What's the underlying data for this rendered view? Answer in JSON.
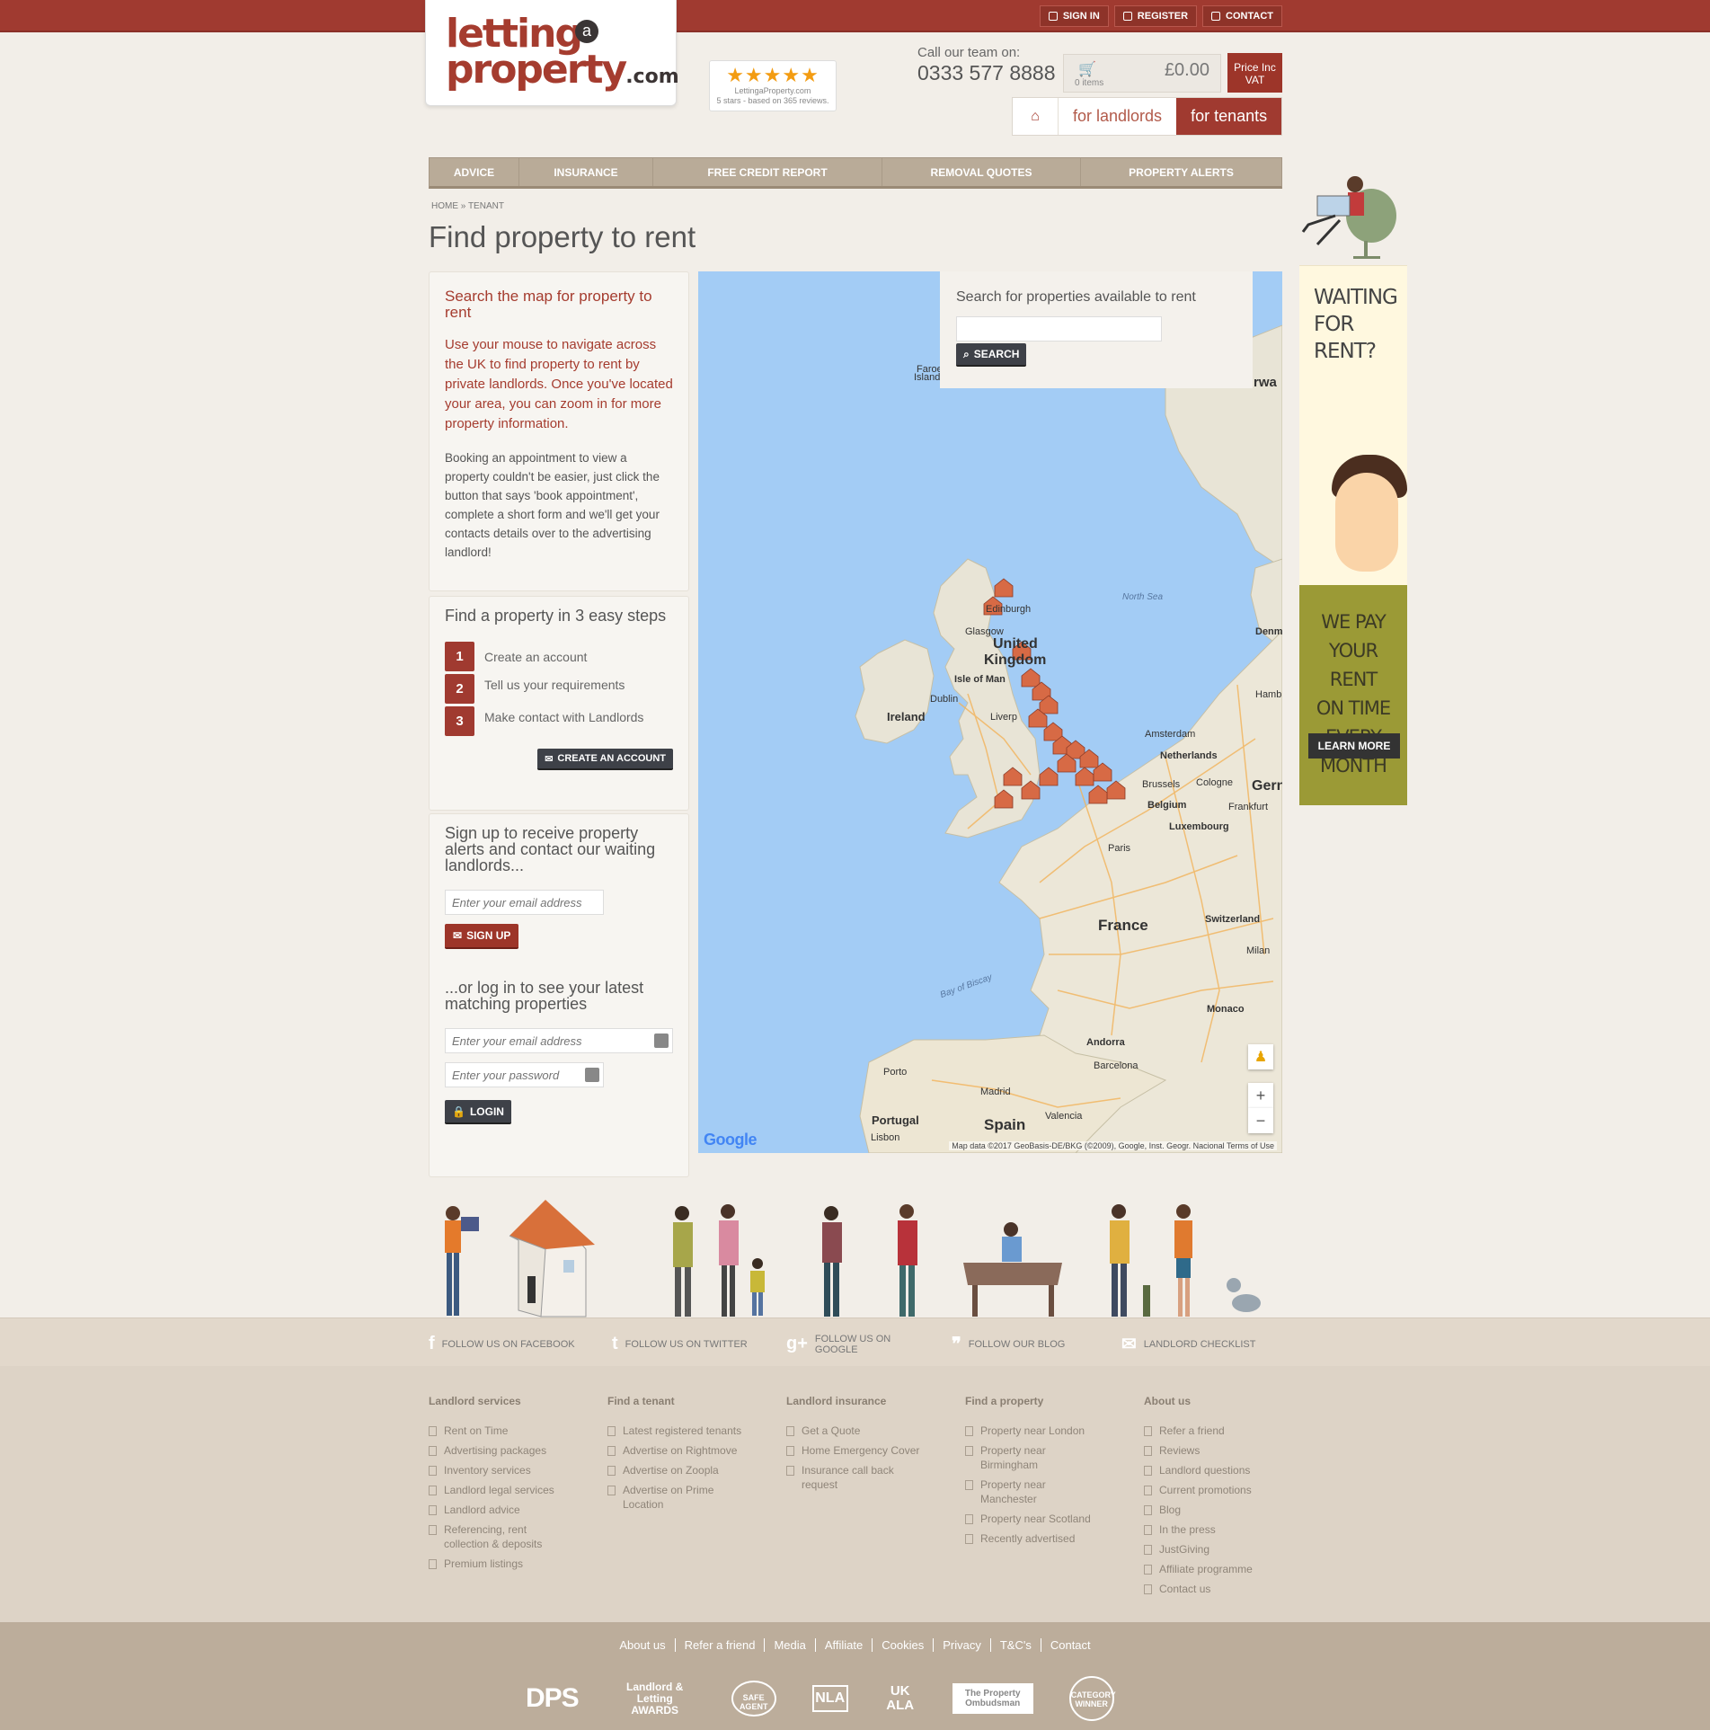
{
  "topbar": {
    "sign_in": "SIGN IN",
    "register": "REGISTER",
    "contact": "CONTACT"
  },
  "logo": {
    "line1": "letting",
    "a": "a",
    "line2": "property",
    "dotcom": ".com"
  },
  "reviews": {
    "stars": "★★★★★",
    "site": "LettingaProperty.com",
    "summary": "5 stars - based on 365 reviews."
  },
  "header": {
    "call_label": "Call our team on:",
    "phone": "0333 577 8888"
  },
  "cart": {
    "items": "0 items",
    "total": "£0.00",
    "vat_line1": "Price Inc",
    "vat_line2": "VAT"
  },
  "role_tabs": {
    "landlords": "for landlords",
    "tenants": "for tenants"
  },
  "nav": [
    "ADVICE",
    "INSURANCE",
    "FREE CREDIT REPORT",
    "REMOVAL QUOTES",
    "PROPERTY ALERTS"
  ],
  "breadcrumb": "HOME » TENANT",
  "page_title": "Find property to rent",
  "intro": {
    "title": "Search the map for property to rent",
    "lead": "Use your mouse to navigate across the UK to find property to rent by private landlords. Once you've located your area, you can zoom in for more property information.",
    "body": "Booking an appointment to view a property couldn't be easier, just click the button that says 'book appointment', complete a short form and we'll get your contacts details over to the advertising landlord!"
  },
  "steps": {
    "title": "Find a property in 3 easy steps",
    "items": [
      {
        "num": "1",
        "label": "Create an account"
      },
      {
        "num": "2",
        "label": "Tell us your requirements"
      },
      {
        "num": "3",
        "label": "Make contact with Landlords"
      }
    ],
    "button": "CREATE AN ACCOUNT"
  },
  "signup": {
    "title": "Sign up to receive property alerts and contact our waiting landlords...",
    "email_placeholder": "Enter your email address",
    "button": "SIGN UP",
    "login_title": "...or log in to see your latest matching properties",
    "login_email_placeholder": "Enter your email address",
    "password_placeholder": "Enter your password",
    "login_button": "LOGIN"
  },
  "map": {
    "search_title": "Search for properties available to rent",
    "search_button": "SEARCH",
    "labels": {
      "faroe": "Faroe",
      "faroe2": "Island",
      "norway": "rwa",
      "north_sea": "North Sea",
      "edinburgh": "Edinburgh",
      "glasgow": "Glasgow",
      "uk1": "United",
      "uk2": "Kingdom",
      "isle_of_man": "Isle of Man",
      "dublin": "Dublin",
      "ireland": "Ireland",
      "liverpool": "Liverp",
      "denmark": "Denm",
      "hamburg": "Hamb",
      "amsterdam": "Amsterdam",
      "netherlands": "Netherlands",
      "brussels": "Brussels",
      "belgium": "Belgium",
      "cologne": "Cologne",
      "germany": "Gern",
      "frankfurt": "Frankfurt",
      "luxembourg": "Luxembourg",
      "paris": "Paris",
      "france": "France",
      "switzerland": "Switzerland",
      "milan": "Milan",
      "monaco": "Monaco",
      "bay_of_biscay": "Bay of Biscay",
      "andorra": "Andorra",
      "porto": "Porto",
      "barcelona": "Barcelona",
      "madrid": "Madrid",
      "portugal": "Portugal",
      "spain": "Spain",
      "valencia": "Valencia",
      "lisbon": "Lisbon"
    },
    "google": "Google",
    "attribution": "Map data ©2017 GeoBasis-DE/BKG (©2009), Google, Inst. Geogr. Nacional    Terms of Use",
    "zoom_in": "+",
    "zoom_out": "−"
  },
  "ad": {
    "title1": "WAITING",
    "title2": "FOR RENT?",
    "line1": "WE PAY",
    "line2": "YOUR RENT",
    "line3": "ON TIME",
    "line4": "EVERY MONTH",
    "button": "LEARN MORE"
  },
  "social": [
    {
      "icon": "f",
      "label": "FOLLOW US ON FACEBOOK"
    },
    {
      "icon": "t",
      "label": "FOLLOW US ON TWITTER"
    },
    {
      "icon": "g+",
      "label": "FOLLOW US ON GOOGLE"
    },
    {
      "icon": "❞",
      "label": "FOLLOW OUR BLOG"
    },
    {
      "icon": "✉",
      "label": "LANDLORD CHECKLIST"
    }
  ],
  "footer_columns": [
    {
      "title": "Landlord services",
      "links": [
        "Rent on Time",
        "Advertising packages",
        "Inventory services",
        "Landlord legal services",
        "Landlord advice",
        "Referencing, rent collection & deposits",
        "Premium listings"
      ]
    },
    {
      "title": "Find a tenant",
      "links": [
        "Latest registered tenants",
        "Advertise on Rightmove",
        "Advertise on Zoopla",
        "Advertise on Prime Location"
      ]
    },
    {
      "title": "Landlord insurance",
      "links": [
        "Get a Quote",
        "Home Emergency Cover",
        "Insurance call back request"
      ]
    },
    {
      "title": "Find a property",
      "links": [
        "Property near London",
        "Property near Birmingham",
        "Property near Manchester",
        "Property near Scotland",
        "Recently advertised"
      ]
    },
    {
      "title": "About us",
      "links": [
        "Refer a friend",
        "Reviews",
        "Landlord questions",
        "Current promotions",
        "Blog",
        "In the press",
        "JustGiving",
        "Affiliate programme",
        "Contact us"
      ]
    }
  ],
  "bottom_links": [
    "About us",
    "Refer a friend",
    "Media",
    "Affiliate",
    "Cookies",
    "Privacy",
    "T&C's",
    "Contact"
  ],
  "badges": {
    "dps": "DPS",
    "awards": "Landlord & Letting AWARDS",
    "safeagent": "SAFE AGENT",
    "nla": "NLA",
    "ukala": "UK ALA",
    "ombudsman": "The Property Ombudsman",
    "winner": "CATEGORY WINNER"
  }
}
